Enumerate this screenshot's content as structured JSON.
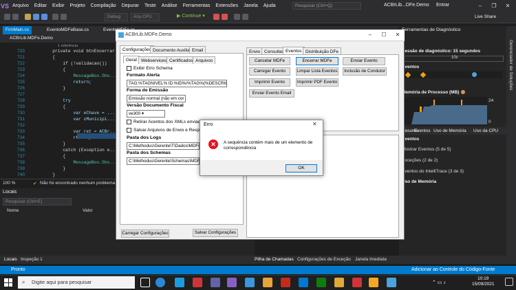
{
  "vs": {
    "logo": "VS",
    "menu": [
      "Arquivo",
      "Editar",
      "Exibir",
      "Projeto",
      "Compilação",
      "Depurar",
      "Teste",
      "Análise",
      "Ferramentas",
      "Extensões",
      "Janela",
      "Ajuda"
    ],
    "search_placeholder": "Pesquisar (Ctrl+Q)",
    "title": "ACBrLib...DFe.Demo",
    "signin": "Entrar",
    "config_select": "Debug",
    "cpu_select": "Any CPU",
    "continue_label": "▶ Continue ▾",
    "live_share": "Live Share",
    "doc_tabs": [
      "FrmMain.cs",
      "EventoMDFeBase.cs",
      "EventoMDFe.cs"
    ],
    "nav_project": "ACBrLib.MDFe.Demo",
    "status_zoom": "100 %",
    "status_issues": "Não foi encontrado nenhum problema",
    "locals_title": "Locais",
    "locals_search": "Pesquisar (Ctrl+E)",
    "locals_cols": [
      "Nome",
      "Valor"
    ],
    "bottom_tabs_left": [
      "Locais",
      "Inspeção 1"
    ],
    "bottom_tabs_right": [
      "Pilha de Chamadas",
      "Configurações de Exceção",
      "Janela Imediata"
    ],
    "status_ready": "Pronto",
    "status_source": "Adicionar ao Controle do Código-Fonte"
  },
  "code": {
    "lines": [
      {
        "n": "720",
        "t": "        private void btnEncerrar..."
      },
      {
        "n": "721",
        "t": "        {"
      },
      {
        "n": "722",
        "t": "            if (!validacao())"
      },
      {
        "n": "723",
        "t": "            {"
      },
      {
        "n": "724",
        "t": "                MessageBox.Sho..."
      },
      {
        "n": "725",
        "t": "                return;"
      },
      {
        "n": "726",
        "t": "            }"
      },
      {
        "n": "727",
        "t": ""
      },
      {
        "n": "728",
        "t": "            try"
      },
      {
        "n": "729",
        "t": "            {"
      },
      {
        "n": "730",
        "t": "                var eChave = ..."
      },
      {
        "n": "731",
        "t": "                var cMunicipi..."
      },
      {
        "n": "732",
        "t": ""
      },
      {
        "n": "733",
        "t": "                var ret = ACBr..."
      },
      {
        "n": "734",
        "t": "                rtbRespostas.a..."
      },
      {
        "n": "735",
        "t": "            }"
      },
      {
        "n": "736",
        "t": "            catch (Exception e..."
      },
      {
        "n": "737",
        "t": "            {"
      },
      {
        "n": "738",
        "t": "                MessageBox.Sho..."
      },
      {
        "n": "739",
        "t": "            }"
      },
      {
        "n": "740",
        "t": "        }"
      }
    ],
    "refs": "1 referência"
  },
  "diag": {
    "title": "Ferramentas de Diagnóstico",
    "session": "Sessão de diagnóstico: 15 segundos",
    "timeline_label": "10s",
    "events_section": "Eventos",
    "memory_section": "Memória de Processo (MB)",
    "mem_value": "24",
    "mem_zero": "0",
    "tabs": [
      "Resumo",
      "Eventos",
      "Uso de Memória",
      "Uso da CPU"
    ],
    "events_header": "Eventos",
    "items": [
      "Mostrar Eventos (5 de 5)",
      "Exceções (2 de 2)",
      "Eventos do IntelliTrace (3 de 3)"
    ],
    "memory_header": "Uso de Memória",
    "side_label": "Gerenciador de Soluções"
  },
  "app": {
    "title": "ACBrLib.MDFe.Demo",
    "left_tabs": [
      "Configurações",
      "Documento Auxiliar",
      "Email"
    ],
    "sub_tabs": [
      "Geral",
      "Webservices",
      "Certificados",
      "Arquivos"
    ],
    "exibir_erro": "Exibir Erro Schema",
    "formato_alerta_label": "Formato Alerta",
    "formato_alerta_value": "TAG:%TAGNIVEL% ID:%ID%/%TAG%(%DESCRICAO%",
    "forma_emissao_label": "Forma de Emissão",
    "forma_emissao_value": "Emissão normal (não em cor ▾",
    "versao_label": "Versão Documento Fiscal",
    "versao_value": "ve300 ▾",
    "retirar_acentos": "Retirar Acentos dos XMLs enviados",
    "salvar_arquivos": "Salvar Arquivos de Envio e Resposta",
    "pasta_logs_label": "Pasta dos Logs",
    "pasta_logs_value": "C:\\Methodus\\Gerente\\T\\Dados\\MDFe\\L",
    "pasta_schemas_label": "Pasta dos Schemas",
    "pasta_schemas_value": "C:\\Methodus\\Gerente\\Schemas\\MDFe\\",
    "btn_carregar_config": "Carregar Configurações",
    "btn_salvar_config": "Salvar Configurações",
    "right_tabs": [
      "Envio",
      "Consultas",
      "Eventos",
      "Distribuição DFe"
    ],
    "event_buttons": [
      "Cancelar MDFe",
      "Encerrar MDFe",
      "Enviar Evento",
      "Carregar Evento",
      "Limpar Lista Eventos",
      "Inclusão de Condutor",
      "Imprimir Evento",
      "Imprimir PDF Evento",
      "Enviar Evento Email"
    ]
  },
  "dialog": {
    "title": "Erro",
    "close": "✕",
    "message": "A sequência contém mais de um elemento de correspondência",
    "ok": "OK"
  },
  "taskbar": {
    "search": "Digite aqui para pesquisar",
    "time": "10:19",
    "date": "15/09/2021"
  }
}
